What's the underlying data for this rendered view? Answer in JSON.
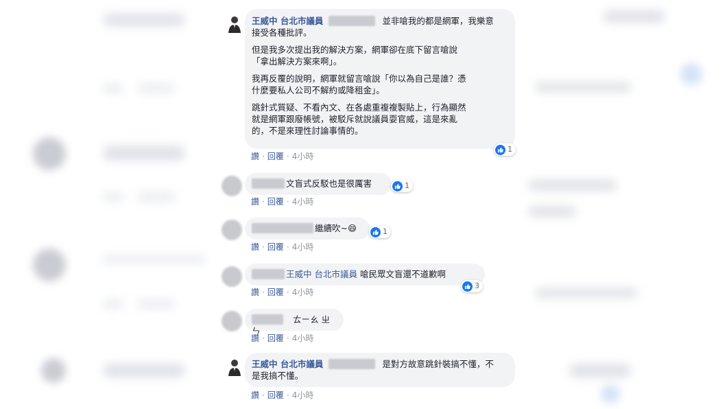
{
  "comments": [
    {
      "author": "王威中 台北市議員",
      "para1_tail": "並非嗆我的都是網軍，我樂意",
      "para1_line2": "接受各種批評。",
      "para2_line1": "但是我多次提出我的解決方案，網軍卻在底下留言嗆說",
      "para2_line2": "「拿出解決方案來啊」。",
      "para3_line1": "我再反覆的說明，網軍就留言嗆說「你以為自己是誰？憑",
      "para3_line2": "什麼要私人公司不解約或降租金」。",
      "para4_line1": "跳針式質疑、不看內文、在各處重複複製貼上，行為顯然",
      "para4_line2": "就是網軍跟廢帳號，被駁斥就說議員耍官威，這是來亂",
      "para4_line3": "的，不是來理性討論事情的。",
      "reaction_count": "1"
    },
    {
      "text": "文盲式反駁也是很厲害",
      "reaction_count": "1"
    },
    {
      "text": "繼續吹~😄",
      "reaction_count": "1"
    },
    {
      "mention": "王威中 台北市議員",
      "text": "嗆民眾文盲還不道歉啊",
      "reaction_count": "3"
    },
    {
      "text": "ㄊㄧㄠ ㄓㄣ"
    },
    {
      "author": "王威中 台北市議員",
      "line1_tail": "是對方故意跳針裝搞不懂，不",
      "line2": "是我搞不懂。"
    }
  ],
  "actions": {
    "like": "讚",
    "reply": "回覆",
    "time": "4小時"
  },
  "colors": {
    "link": "#385898",
    "bubble": "#f2f3f5",
    "like": "#1877f2"
  }
}
